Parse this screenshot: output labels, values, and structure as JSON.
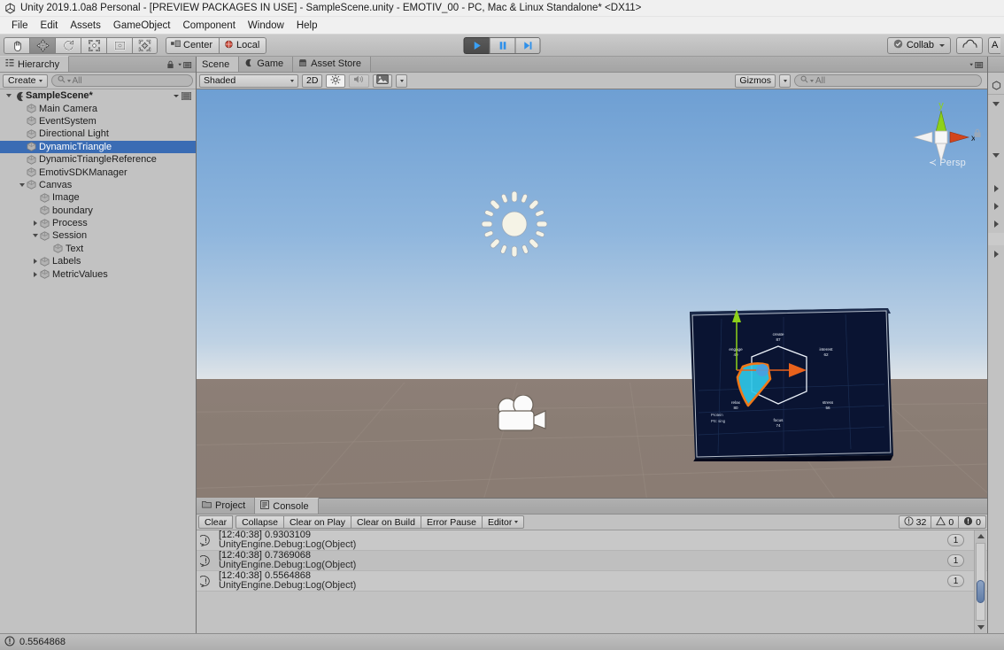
{
  "window": {
    "title": "Unity 2019.1.0a8 Personal - [PREVIEW PACKAGES IN USE] - SampleScene.unity - EMOTIV_00 - PC, Mac & Linux Standalone* <DX11>",
    "logo_icon": "unity-logo-icon"
  },
  "menu": {
    "items": [
      "File",
      "Edit",
      "Assets",
      "GameObject",
      "Component",
      "Window",
      "Help"
    ]
  },
  "toolbar": {
    "tools": [
      {
        "name": "hand-tool",
        "icon": "hand-icon",
        "active": false
      },
      {
        "name": "move-tool",
        "icon": "move-icon",
        "active": true
      },
      {
        "name": "rotate-tool",
        "icon": "rotate-icon",
        "active": false
      },
      {
        "name": "scale-tool",
        "icon": "scale-icon",
        "active": false
      },
      {
        "name": "rect-tool",
        "icon": "rect-icon",
        "active": false
      },
      {
        "name": "transform-tool",
        "icon": "transform-icon",
        "active": false
      }
    ],
    "pivot_label": "Center",
    "pivot_icon": "pivot-center-icon",
    "handle_label": "Local",
    "handle_icon": "handle-local-icon",
    "play_label": "play-icon",
    "pause_label": "pause-icon",
    "step_label": "step-icon",
    "play_active": true,
    "collab_label": "Collab",
    "collab_icon": "collab-check-icon",
    "cloud_icon": "cloud-icon",
    "account_label": "A"
  },
  "hierarchy": {
    "tab_label": "Hierarchy",
    "tab_icon": "hierarchy-icon",
    "create_label": "Create",
    "search_placeholder": "All",
    "search_value": "",
    "search_icon": "search-icon",
    "lock_icon": "lock-icon",
    "menu_icon": "panel-menu-icon",
    "items": [
      {
        "label": "SampleScene*",
        "depth": 0,
        "expander": "down",
        "icon": "scene-icon",
        "selected": false,
        "root": true
      },
      {
        "label": "Main Camera",
        "depth": 1,
        "expander": "none",
        "icon": "gameobject-icon",
        "selected": false
      },
      {
        "label": "EventSystem",
        "depth": 1,
        "expander": "none",
        "icon": "gameobject-icon",
        "selected": false
      },
      {
        "label": "Directional Light",
        "depth": 1,
        "expander": "none",
        "icon": "gameobject-icon",
        "selected": false
      },
      {
        "label": "DynamicTriangle",
        "depth": 1,
        "expander": "none",
        "icon": "gameobject-icon",
        "selected": true
      },
      {
        "label": "DynamicTriangleReference",
        "depth": 1,
        "expander": "none",
        "icon": "gameobject-icon",
        "selected": false
      },
      {
        "label": "EmotivSDKManager",
        "depth": 1,
        "expander": "none",
        "icon": "gameobject-icon",
        "selected": false
      },
      {
        "label": "Canvas",
        "depth": 1,
        "expander": "down",
        "icon": "gameobject-icon",
        "selected": false
      },
      {
        "label": "Image",
        "depth": 2,
        "expander": "none",
        "icon": "gameobject-icon",
        "selected": false
      },
      {
        "label": "boundary",
        "depth": 2,
        "expander": "none",
        "icon": "gameobject-icon",
        "selected": false
      },
      {
        "label": "Process",
        "depth": 2,
        "expander": "right",
        "icon": "gameobject-icon",
        "selected": false
      },
      {
        "label": "Session",
        "depth": 2,
        "expander": "down",
        "icon": "gameobject-icon",
        "selected": false
      },
      {
        "label": "Text",
        "depth": 3,
        "expander": "none",
        "icon": "gameobject-icon",
        "selected": false
      },
      {
        "label": "Labels",
        "depth": 2,
        "expander": "right",
        "icon": "gameobject-icon",
        "selected": false
      },
      {
        "label": "MetricValues",
        "depth": 2,
        "expander": "right",
        "icon": "gameobject-icon",
        "selected": false
      }
    ]
  },
  "scene": {
    "tabs": [
      {
        "label": "Scene",
        "icon": "scene-tab-icon",
        "active": true
      },
      {
        "label": "Game",
        "icon": "game-tab-icon",
        "active": false
      },
      {
        "label": "Asset Store",
        "icon": "asset-store-icon",
        "active": false
      }
    ],
    "draw_mode": "Shaded",
    "mode_2d": "2D",
    "lighting_icon": "lighting-icon",
    "lighting_on": true,
    "audio_icon": "audio-icon",
    "audio_on": false,
    "fx_icon": "effects-icon",
    "gizmos_label": "Gizmos",
    "search_placeholder": "All",
    "search_icon": "search-icon",
    "menu_icon": "panel-menu-icon",
    "nav_gizmo": {
      "x_label": "x",
      "y_label": "y",
      "projection": "Persp",
      "x_color": "#d3451c",
      "y_color": "#8ed11a",
      "z_color": "#ffffff"
    },
    "gizmos_in_view": [
      {
        "name": "directional-light-gizmo",
        "icon": "sun-icon"
      },
      {
        "name": "main-camera-gizmo",
        "icon": "camera-icon"
      }
    ],
    "canvas_object": {
      "name": "emotiv-metrics-canvas",
      "background": "#0a1430",
      "shape_fill": "#2fc8e8",
      "shape_outline": "#f07818",
      "radar_line": "#e8eef6",
      "labels": [
        {
          "text": "create",
          "value": "87"
        },
        {
          "text": "interest",
          "value": "62"
        },
        {
          "text": "stress",
          "value": "56"
        },
        {
          "text": "focus",
          "value": "74"
        },
        {
          "text": "relax",
          "value": "80"
        },
        {
          "text": "engage",
          "value": "49"
        }
      ],
      "corner_text": [
        "Protein",
        "PS: sing"
      ]
    },
    "move_gizmo": {
      "y_axis_color": "#8ed11a",
      "x_axis_color": "#e8621c",
      "center_color": "#4a9fe0"
    }
  },
  "console": {
    "tabs": [
      {
        "label": "Project",
        "icon": "project-icon",
        "active": false
      },
      {
        "label": "Console",
        "icon": "console-icon",
        "active": true
      }
    ],
    "buttons": [
      {
        "label": "Clear",
        "name": "clear-button",
        "dropdown": false
      },
      {
        "label": "Collapse",
        "name": "collapse-button",
        "dropdown": false
      },
      {
        "label": "Clear on Play",
        "name": "clear-on-play-button",
        "dropdown": false
      },
      {
        "label": "Clear on Build",
        "name": "clear-on-build-button",
        "dropdown": false
      },
      {
        "label": "Error Pause",
        "name": "error-pause-button",
        "dropdown": false
      },
      {
        "label": "Editor",
        "name": "editor-dropdown",
        "dropdown": true
      }
    ],
    "counters": [
      {
        "name": "info-count",
        "icon": "info-icon",
        "value": "32"
      },
      {
        "name": "warning-count",
        "icon": "warning-icon",
        "value": "0"
      },
      {
        "name": "error-count",
        "icon": "error-icon",
        "value": "0"
      }
    ],
    "entries": [
      {
        "line1": "[12:40:38] 0.9303109",
        "line2": "UnityEngine.Debug:Log(Object)",
        "count": "1",
        "icon": "info-icon"
      },
      {
        "line1": "[12:40:38] 0.7369068",
        "line2": "UnityEngine.Debug:Log(Object)",
        "count": "1",
        "icon": "info-icon"
      },
      {
        "line1": "[12:40:38] 0.5564868",
        "line2": "UnityEngine.Debug:Log(Object)",
        "count": "1",
        "icon": "info-icon"
      }
    ]
  },
  "statusbar": {
    "icon": "info-icon",
    "text": "0.5564868"
  }
}
